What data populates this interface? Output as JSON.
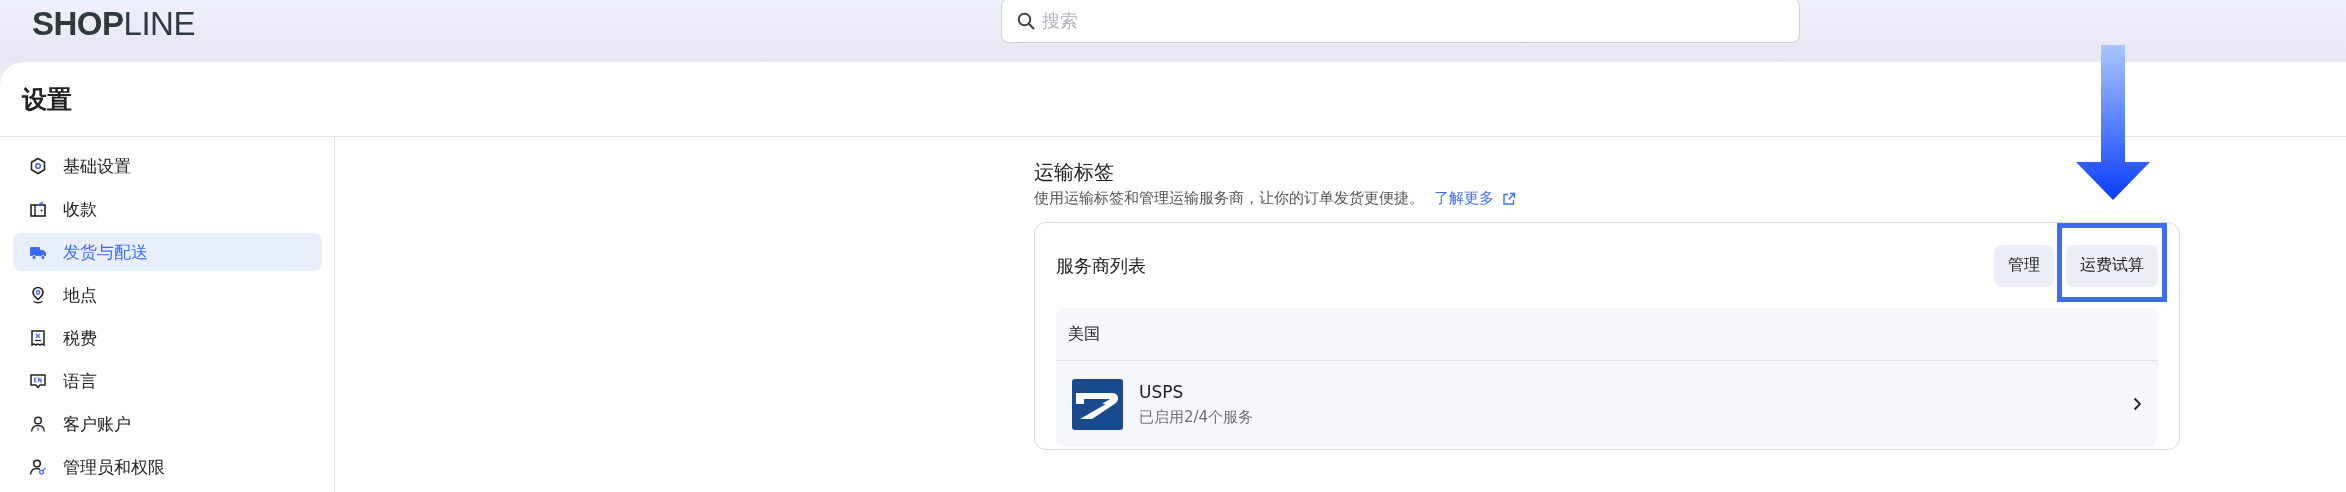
{
  "header": {
    "logo": {
      "bold": "SHOP",
      "light": "LINE"
    },
    "search": {
      "placeholder": "搜索"
    }
  },
  "page": {
    "title": "设置"
  },
  "sidebar": {
    "items": [
      {
        "label": "基础设置",
        "selected": false
      },
      {
        "label": "收款",
        "selected": false
      },
      {
        "label": "发货与配送",
        "selected": true
      },
      {
        "label": "地点",
        "selected": false
      },
      {
        "label": "税费",
        "selected": false
      },
      {
        "label": "语言",
        "selected": false
      },
      {
        "label": "客户账户",
        "selected": false
      },
      {
        "label": "管理员和权限",
        "selected": false
      }
    ]
  },
  "section": {
    "title": "运输标签",
    "description": "使用运输标签和管理运输服务商，让你的订单发货更便捷。",
    "link": "了解更多",
    "card": {
      "title": "服务商列表",
      "buttons": [
        {
          "label": "管理",
          "highlighted": false
        },
        {
          "label": "运费试算",
          "highlighted": true
        }
      ],
      "groups": [
        {
          "country": "美国",
          "carriers": [
            {
              "name": "USPS",
              "status": "已启用2/4个服务"
            }
          ]
        }
      ]
    }
  }
}
